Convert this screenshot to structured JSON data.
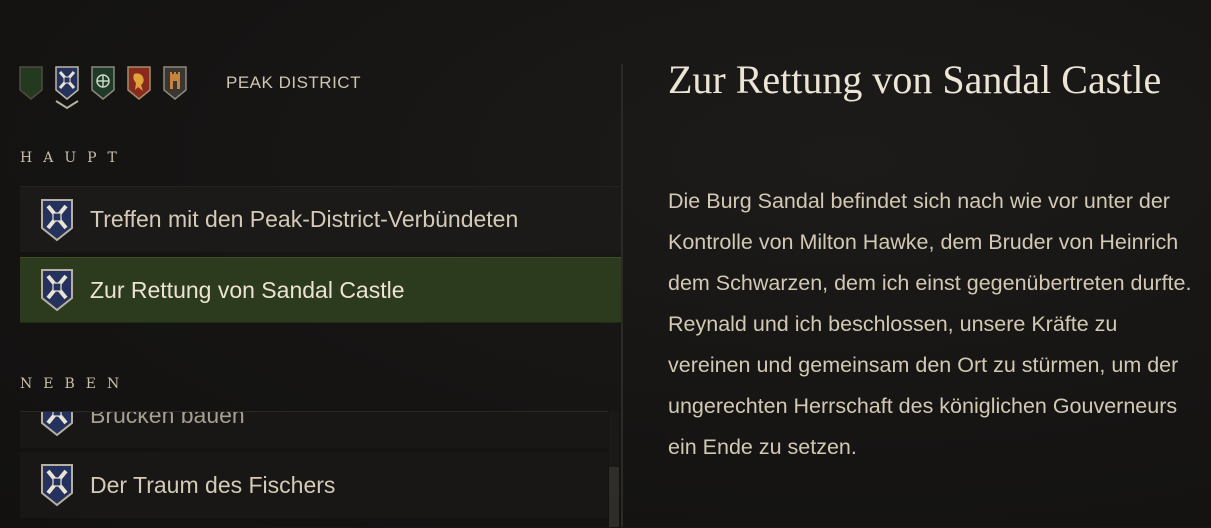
{
  "region_bar": {
    "tabs": [
      {
        "name": "green-banner",
        "active": false
      },
      {
        "name": "blue-cross-crest",
        "active": true
      },
      {
        "name": "green-knot-crest",
        "active": false
      },
      {
        "name": "red-lion-crest",
        "active": false
      },
      {
        "name": "grey-tower-crest",
        "active": false
      }
    ],
    "region_name": "PEAK DISTRICT"
  },
  "quest_log": {
    "main_header": "HAUPT",
    "side_header": "NEBEN",
    "main_quests": [
      {
        "label": "Treffen mit den Peak-District-Verbündeten",
        "icon": "blue-cross-crest-icon",
        "selected": false
      },
      {
        "label": "Zur Rettung von Sandal Castle",
        "icon": "blue-cross-crest-icon",
        "selected": true
      }
    ],
    "side_quests": [
      {
        "label": "Brücken bauen",
        "icon": "blue-cross-crest-icon"
      },
      {
        "label": "Der Traum des Fischers",
        "icon": "blue-cross-crest-icon"
      }
    ]
  },
  "detail": {
    "title": "Zur Rettung von Sandal Castle",
    "body": "Die Burg Sandal befindet sich nach wie vor unter der Kontrolle von Milton Hawke, dem Bruder von Heinrich dem Schwarzen, dem ich einst gegenübertreten durfte. Reynald und ich beschlossen, unsere Kräfte zu vereinen und gemeinsam den Ort zu stürmen, um der ungerechten Herrschaft des königlichen Gouverneurs ein Ende zu setzen."
  },
  "colors": {
    "background": "#151413",
    "selected_row": "#2c3a1d",
    "text": "#d4cab7",
    "crest_blue": "#26325e"
  }
}
